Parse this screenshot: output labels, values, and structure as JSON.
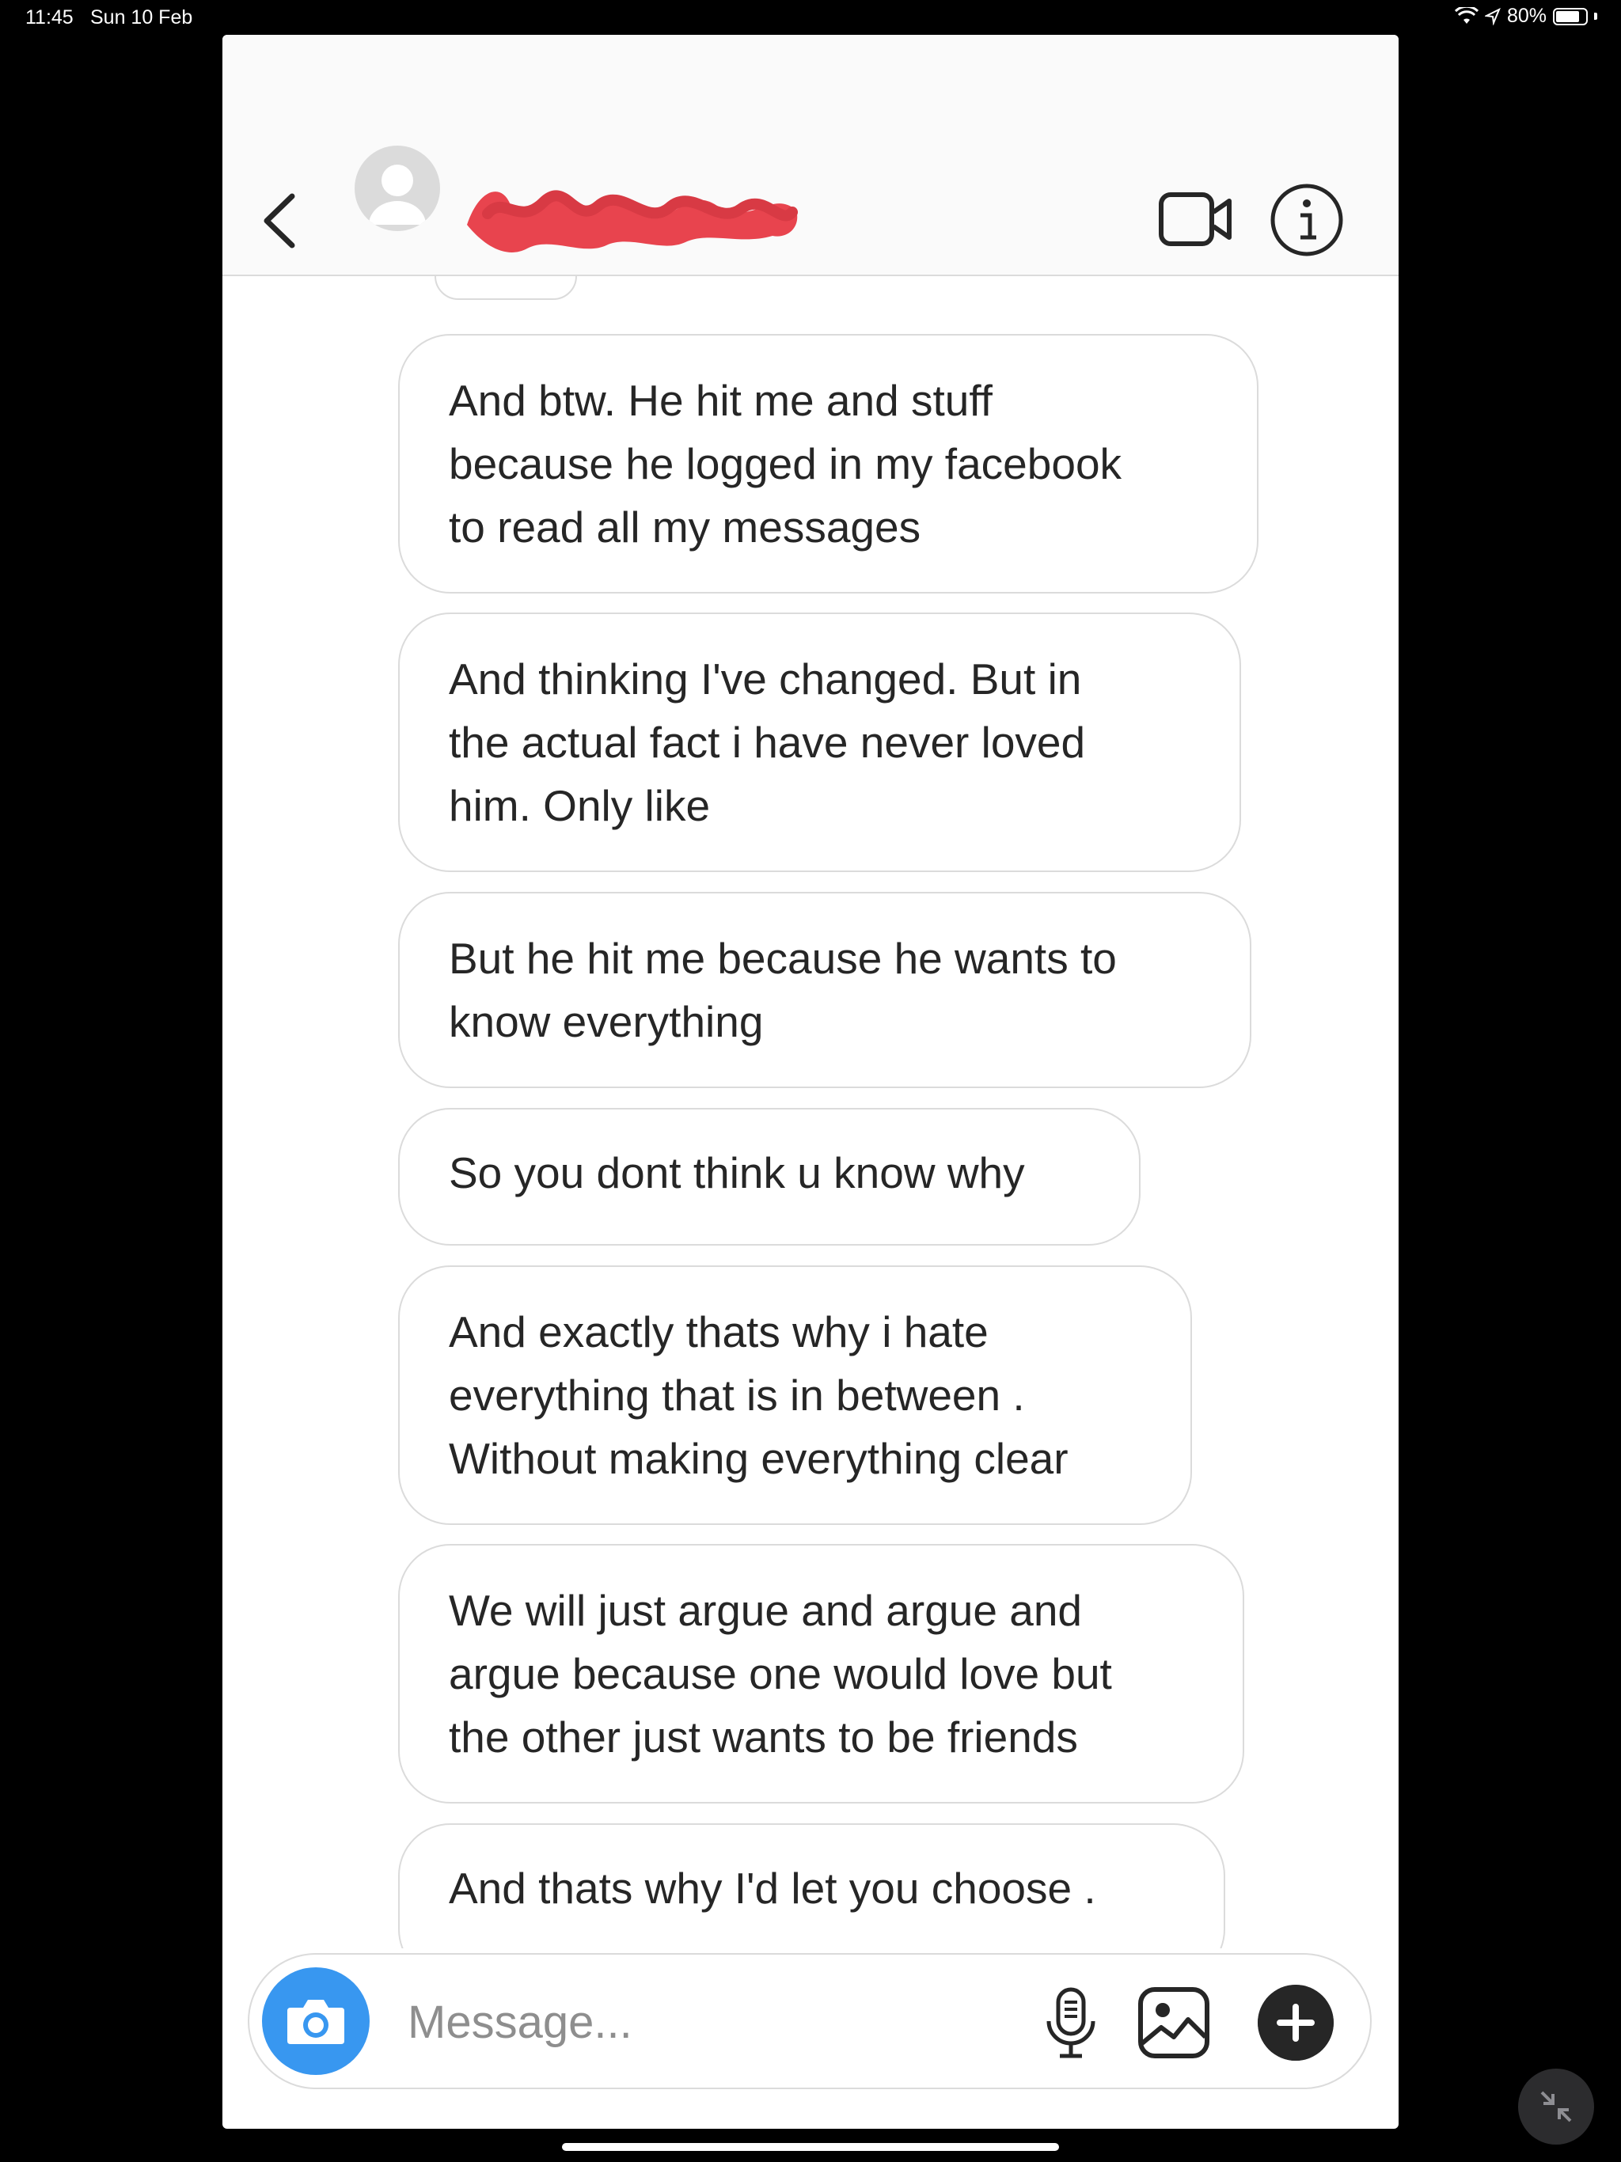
{
  "status_bar": {
    "time": "11:45",
    "date": "Sun 10 Feb",
    "battery": "80%",
    "battery_level": 0.8
  },
  "header": {
    "back_icon": "chevron-left-icon",
    "avatar_icon": "user-avatar-icon",
    "video_icon": "video-camera-icon",
    "info_icon": "info-icon"
  },
  "messages": [
    {
      "lines": [
        "And btw.  He hit me and stuff",
        "because he logged in my facebook",
        "to read all my messages"
      ]
    },
    {
      "lines": [
        "And thinking I've changed.   But in",
        "the actual fact i have never loved",
        "him. Only like"
      ]
    },
    {
      "lines": [
        "But he hit me because he wants to",
        "know everything"
      ]
    },
    {
      "lines": [
        "So you dont think u know why"
      ]
    },
    {
      "lines": [
        "And exactly thats why i hate",
        "everything that is in between .",
        "Without making everything clear"
      ]
    },
    {
      "lines": [
        "We will just argue and argue and",
        "argue because one would love but",
        "the other just wants to be friends"
      ]
    },
    {
      "lines": [
        "And thats why I'd let you choose ."
      ]
    }
  ],
  "composer": {
    "placeholder": "Message...",
    "camera_icon": "camera-icon",
    "mic_icon": "microphone-icon",
    "gallery_icon": "image-gallery-icon",
    "plus_icon": "plus-icon"
  },
  "colors": {
    "accent": "#3897f0",
    "redaction": "#e8444e",
    "bubble_border": "#dbdbdb",
    "text": "#262626"
  }
}
